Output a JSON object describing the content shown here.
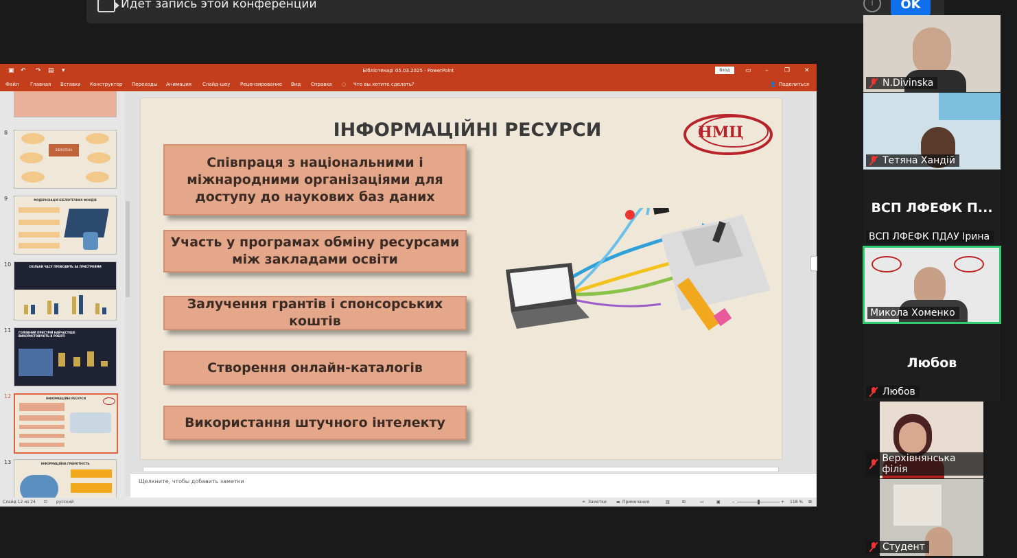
{
  "banner": {
    "text": "Идет запись этой конференции",
    "ok_label": "OK",
    "info": "i"
  },
  "ppt": {
    "window_title": "Бібліотекарі 05.03.2025  -  PowerPoint",
    "signin_label": "Вход",
    "menu": [
      "Файл",
      "Главная",
      "Вставка",
      "Конструктор",
      "Переходы",
      "Анимация",
      "Слайд-шоу",
      "Рецензирование",
      "Вид",
      "Справка",
      "Что вы хотите сделать?"
    ],
    "share_label": "Поделиться",
    "thumbnails": [
      {
        "num": "8",
        "title": "БІБЛІОТЕКА"
      },
      {
        "num": "9",
        "title": "МОДЕРНІЗАЦІЯ БІБЛІОТЕЧНИХ ФОНДІВ"
      },
      {
        "num": "10",
        "title": "СКІЛЬКИ ЧАСУ ПРОВОДИТЬ ЗА ПРИСТРОЯМИ"
      },
      {
        "num": "11",
        "title": "ГОЛОВНИЙ ПРИСТРІЙ НАЙЧАСТІШЕ ВИКОРИСТОВУЮТЬ В РОБОТІ"
      },
      {
        "num": "12",
        "title": "ІНФОРМАЦІЙНІ РЕСУРСИ"
      },
      {
        "num": "13",
        "title": "ІНФОРМАЦІЙНА ГРАМОТНІСТЬ"
      }
    ],
    "slide": {
      "title": "ІНФОРМАЦІЙНІ РЕСУРСИ",
      "logo_text": "НМЦ",
      "boxes": [
        "Співпраця з національними і міжнародними організаціями для доступу до наукових баз даних",
        "Участь у програмах обміну ресурсами між закладами освіти",
        "Залучення грантів і спонсорських коштів",
        "Створення онлайн-каталогів",
        "Використання штучного інтелекту"
      ]
    },
    "notes_placeholder": "Щелкните, чтобы добавить заметки",
    "status": {
      "slide_info": "Слайд 12 из 24",
      "language": "русский",
      "notes": "Заметки",
      "comments": "Примечания",
      "zoom": "118 %"
    }
  },
  "participants": [
    {
      "name": "N.Divinska"
    },
    {
      "name": "Тетяна Хандій"
    },
    {
      "big_name": "ВСП ЛФЕФК П...",
      "name": "ВСП ЛФЕФК ПДАУ Ірина"
    },
    {
      "name": "Микола Хоменко"
    },
    {
      "big_name": "Любов",
      "name": "Любов"
    },
    {
      "name": "Верхівнянська філія"
    },
    {
      "name": "Студент"
    }
  ],
  "colors": {
    "ppt_red": "#c43e1c",
    "box_fill": "#e4a78a",
    "ok_blue": "#0e71eb",
    "active_speaker": "#2ecc71"
  }
}
